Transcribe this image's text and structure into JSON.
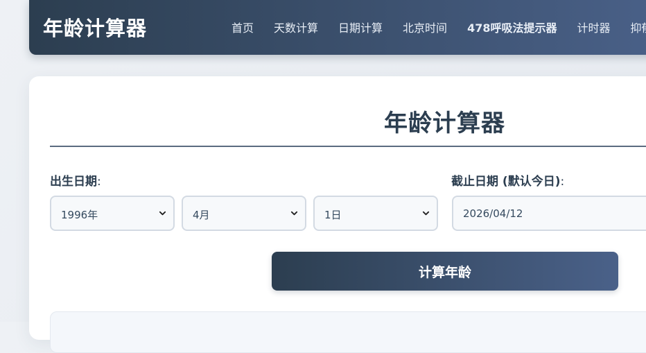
{
  "header": {
    "brand": "年龄计算器",
    "nav": [
      {
        "label": "首页"
      },
      {
        "label": "天数计算"
      },
      {
        "label": "日期计算"
      },
      {
        "label": "北京时间"
      },
      {
        "label": "478呼吸法提示器"
      },
      {
        "label": "计时器"
      },
      {
        "label": "抑郁"
      }
    ]
  },
  "main": {
    "title": "年龄计算器",
    "birth_label": "出生日期",
    "end_label": "截止日期 (默认今日)",
    "colon": ":",
    "birth": {
      "year": "1996年",
      "month": "4月",
      "day": "1日"
    },
    "end_date_value": "2026/04/12",
    "calculate_label": "计算年龄"
  },
  "colors": {
    "primary_dark": "#2c3e50",
    "primary_light": "#4a6189",
    "accent_border": "#d3dae3"
  }
}
